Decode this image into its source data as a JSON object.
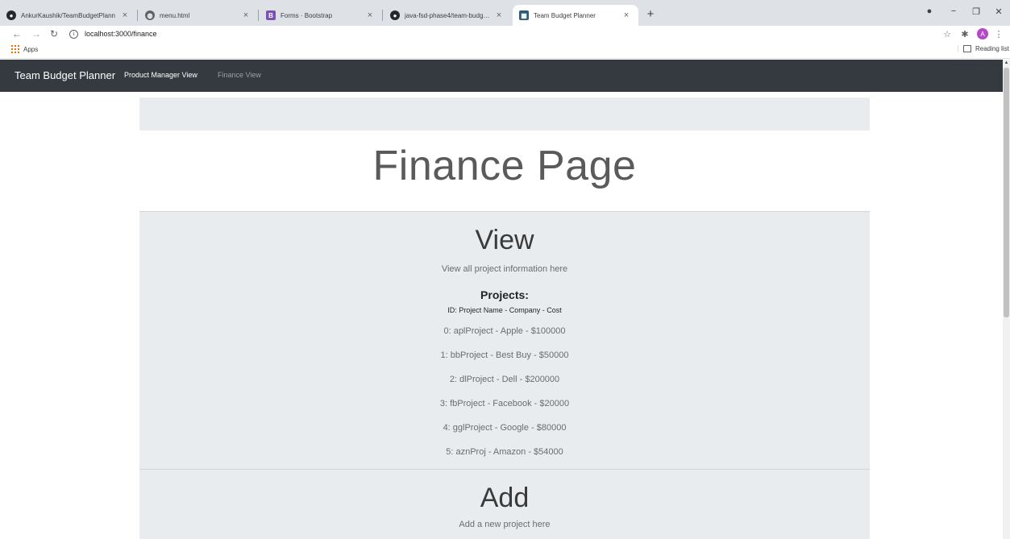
{
  "browser": {
    "tabs": [
      {
        "title": "AnkurKaushik/TeamBudgetPlann",
        "icon": "github-icon"
      },
      {
        "title": "menu.html",
        "icon": "globe-icon"
      },
      {
        "title": "Forms · Bootstrap",
        "icon": "bootstrap-icon"
      },
      {
        "title": "java-fsd-phase4/team-budget-pl",
        "icon": "github-icon"
      },
      {
        "title": "Team Budget Planner",
        "icon": "app-favicon-icon"
      }
    ],
    "address": "localhost:3000/finance",
    "bookmarks": {
      "apps": "Apps",
      "reading_list": "Reading list"
    },
    "profile_initial": "A"
  },
  "navbar": {
    "brand": "Team Budget Planner",
    "links": [
      "Product Manager View",
      "Finance View"
    ]
  },
  "page": {
    "title": "Finance Page",
    "view": {
      "title": "View",
      "subtitle": "View all project information here",
      "projects_heading": "Projects:",
      "projects_legend": "ID: Project Name - Company - Cost",
      "projects": [
        "0: aplProject - Apple - $100000",
        "1: bbProject - Best Buy - $50000",
        "2: dlProject - Dell - $200000",
        "3: fbProject - Facebook - $20000",
        "4: gglProject - Google - $80000",
        "5: aznProj - Amazon - $54000"
      ]
    },
    "add": {
      "title": "Add",
      "subtitle": "Add a new project here"
    }
  },
  "colors": {
    "navbar_bg": "#343a40",
    "section_bg": "#e9ecef"
  }
}
